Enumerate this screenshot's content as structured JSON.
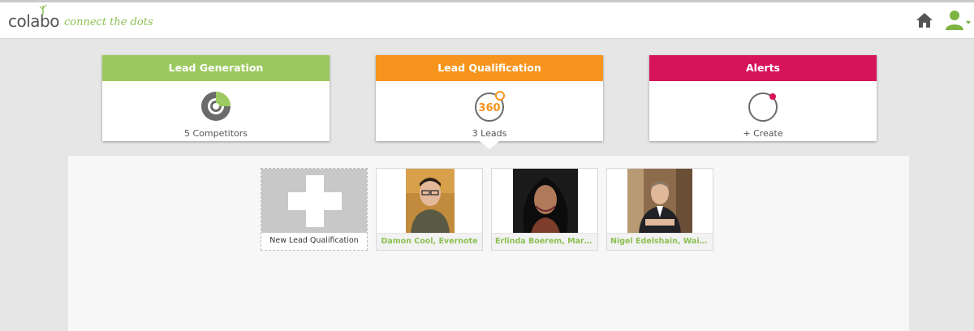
{
  "header": {
    "logo_text": "colabo",
    "tagline": "connect the dots",
    "home_icon": "home-icon",
    "user_icon": "user-icon"
  },
  "colors": {
    "lead_generation": "#9cc95f",
    "lead_qualification": "#f7941d",
    "alerts": "#d6145a",
    "accent_text": "#8cc152"
  },
  "tiles": [
    {
      "title": "Lead Generation",
      "caption": "5 Competitors",
      "icon": "radar-icon"
    },
    {
      "title": "Lead Qualification",
      "caption": "3 Leads",
      "icon": "360-icon",
      "icon_text": "360"
    },
    {
      "title": "Alerts",
      "caption": "+ Create",
      "icon": "alert-circle-icon"
    }
  ],
  "cards": [
    {
      "label": "New Lead Qualification",
      "icon": "plus-icon"
    },
    {
      "label": "Damon Cool, Evernote"
    },
    {
      "label": "Erlinda Boerem, Marc..."
    },
    {
      "label": "Nigel Edelshain, Wain..."
    }
  ]
}
